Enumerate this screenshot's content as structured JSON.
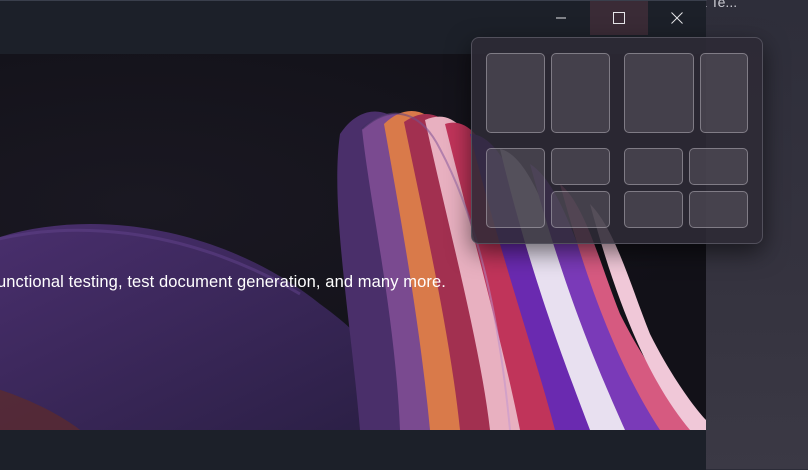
{
  "background_window": {
    "title_fragment": "x Te..."
  },
  "window": {
    "controls": {
      "minimize_icon": "minimize-icon",
      "maximize_icon": "maximize-icon",
      "close_icon": "close-icon"
    },
    "hero": {
      "description": "unctional testing, test document generation, and many more."
    }
  },
  "snap_layouts": {
    "layouts": [
      {
        "name": "two-column-equal",
        "zones": 2
      },
      {
        "name": "two-column-wide-left",
        "zones": 2
      },
      {
        "name": "three-zone-left-tall",
        "zones": 3
      },
      {
        "name": "four-quadrant-grid",
        "zones": 4
      }
    ]
  },
  "colors": {
    "titlebar": "#1c2029",
    "maximize_hover": "#3a2b36",
    "flyout": "#2e2a36"
  }
}
